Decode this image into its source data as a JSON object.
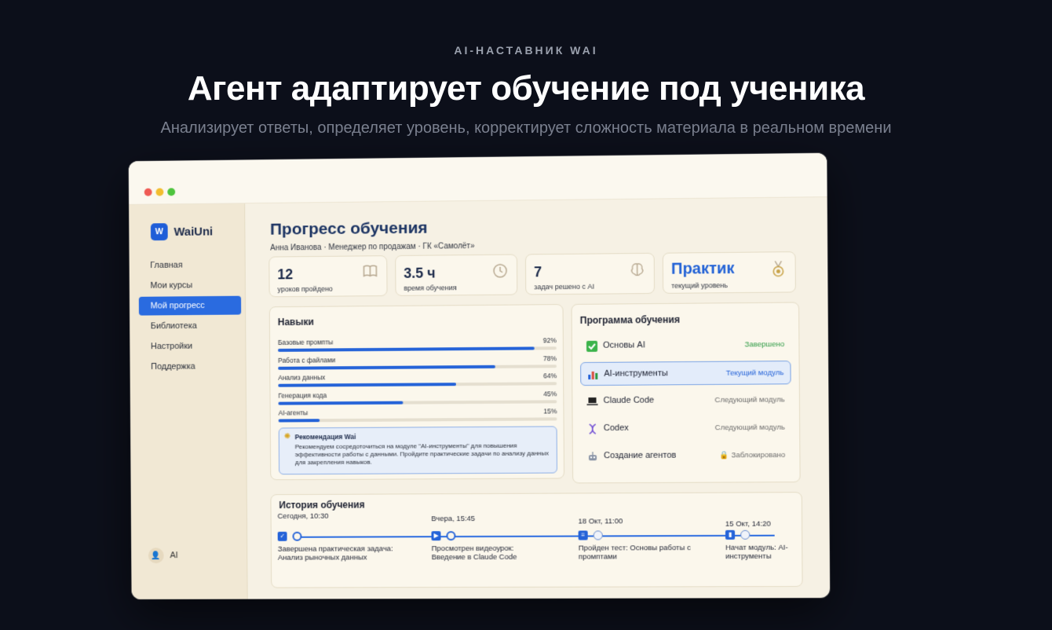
{
  "hero": {
    "kicker": "AI-НАСТАВНИК WAI",
    "title": "Агент адаптирует обучение под ученика",
    "subtitle": "Анализирует ответы, определяет уровень, корректирует сложность материала в реальном времени"
  },
  "app": {
    "logo_mark": "W",
    "logo_text": "WaiUni"
  },
  "sidebar": {
    "items": [
      {
        "label": "Главная"
      },
      {
        "label": "Мои курсы"
      },
      {
        "label": "Мой прогресс"
      },
      {
        "label": "Библиотека"
      },
      {
        "label": "Настройки"
      },
      {
        "label": "Поддержка"
      }
    ],
    "active_index": 2,
    "user_initials": "👤",
    "user_name": "AI"
  },
  "page": {
    "title": "Прогресс обучения",
    "subtitle": "Анна Иванова · Менеджер по продажам · ГК «Самолёт»"
  },
  "stats": [
    {
      "value": "12",
      "label": "уроков пройдено",
      "icon": "book-icon"
    },
    {
      "value": "3.5 ч",
      "label": "время обучения",
      "icon": "clock-icon"
    },
    {
      "value": "7",
      "label": "задач решено с AI",
      "icon": "brain-icon"
    },
    {
      "value": "Практик",
      "label": "текущий уровень",
      "icon": "medal-icon"
    }
  ],
  "skills": {
    "title": "Навыки",
    "items": [
      {
        "name": "Базовые промпты",
        "pct_label": "92%",
        "value": 92
      },
      {
        "name": "Работа с файлами",
        "pct_label": "78%",
        "value": 78
      },
      {
        "name": "Анализ данных",
        "pct_label": "64%",
        "value": 64
      },
      {
        "name": "Генерация кода",
        "pct_label": "45%",
        "value": 45
      },
      {
        "name": "AI-агенты",
        "pct_label": "15%",
        "value": 15
      }
    ],
    "recommendation": {
      "title": "Рекомендация Wai",
      "text": "Рекомендуем сосредоточиться на модуле \"AI-инструменты\" для повышения эффективности работы с данными. Пройдите практические задачи по анализу данных для закрепления навыков."
    }
  },
  "program": {
    "title": "Программа обучения",
    "items": [
      {
        "name": "Основы AI",
        "status": "Завершено",
        "state": "done",
        "icon": "check-icon"
      },
      {
        "name": "AI-инструменты",
        "status": "Текущий модуль",
        "state": "current",
        "icon": "bar-chart-icon"
      },
      {
        "name": "Claude Code",
        "status": "Следующий модуль",
        "state": "next",
        "icon": "laptop-icon"
      },
      {
        "name": "Codex",
        "status": "Следующий модуль",
        "state": "next",
        "icon": "dna-icon"
      },
      {
        "name": "Создание агентов",
        "status": "🔒 Заблокировано",
        "state": "locked",
        "icon": "robot-icon"
      }
    ]
  },
  "history": {
    "title": "История обучения",
    "events": [
      {
        "time": "Сегодня, 10:30",
        "desc": "Завершена практическая задача: Анализ рыночных данных",
        "icon": "checkbox-icon"
      },
      {
        "time": "Вчера, 15:45",
        "desc": "Просмотрен видеоурок: Введение в Claude Code",
        "icon": "video-icon"
      },
      {
        "time": "18 Окт, 11:00",
        "desc": "Пройден тест: Основы работы с промптами",
        "icon": "test-icon"
      },
      {
        "time": "15 Окт, 14:20",
        "desc": "Начат модуль: AI-инструменты",
        "icon": "bar-chart-icon"
      }
    ]
  },
  "colors": {
    "accent": "#2563d8",
    "done": "#2f9b45",
    "background": "#0c0f1a"
  }
}
